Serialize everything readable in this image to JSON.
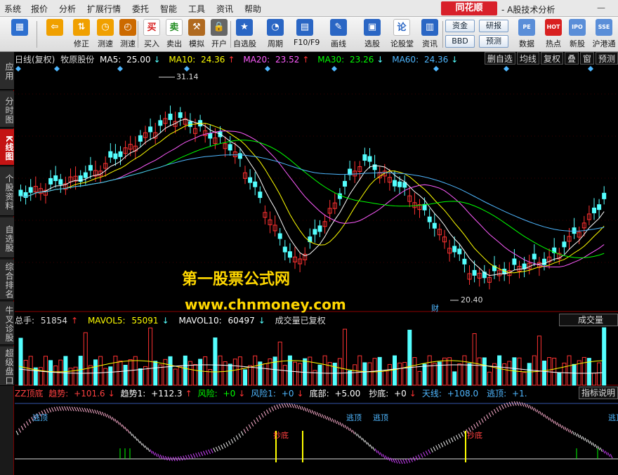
{
  "menu": {
    "items": [
      "系统",
      "报价",
      "分析",
      "扩展行情",
      "委托",
      "智能",
      "工具",
      "资讯",
      "帮助"
    ],
    "brand": "同花顺",
    "app_title": "- A股技术分析",
    "minimize": "—"
  },
  "toolbar": {
    "buttons": [
      {
        "label": "",
        "icon": "window-grid-icon",
        "color": "#2d6fcf"
      },
      {
        "label": "",
        "icon": "back-arrow-icon",
        "color": "#f0a000"
      },
      {
        "label": "修正",
        "icon": "updown-arrow-icon",
        "color": "#f0a000"
      },
      {
        "label": "测速",
        "icon": "speed-icon",
        "color": "#f0a000"
      },
      {
        "label": "测速",
        "icon": "clock-icon",
        "color": "#cc6a00"
      },
      {
        "label": "买入",
        "icon": "buy-icon",
        "color": "#d82020",
        "glyph": "买"
      },
      {
        "label": "卖出",
        "icon": "sell-icon",
        "color": "#208c20",
        "glyph": "卖"
      },
      {
        "label": "模拟",
        "icon": "hammer-icon",
        "color": "#b06a20"
      },
      {
        "label": "开户",
        "icon": "lock-icon",
        "color": "#666"
      },
      {
        "label": "自选股",
        "icon": "star-folder-icon",
        "color": "#2a66c4"
      },
      {
        "label": "周期",
        "icon": "period-clock-icon",
        "color": "#2a66c4"
      },
      {
        "label": "F10/F9",
        "icon": "f10-icon",
        "color": "#2a66c4"
      },
      {
        "label": "画线",
        "icon": "pencil-icon",
        "color": "#2a66c4"
      },
      {
        "label": "选股",
        "icon": "select-stock-icon",
        "color": "#2a66c4"
      },
      {
        "label": "论股堂",
        "icon": "forum-icon",
        "color": "#2a66c4",
        "glyph": "论"
      },
      {
        "label": "资讯",
        "icon": "news-icon",
        "color": "#2a66c4"
      }
    ],
    "boxes": [
      "资金",
      "研报",
      "BBD",
      "预测"
    ],
    "right_buttons": [
      {
        "label": "数据",
        "icon": "pe-data-icon",
        "glyph": "PE"
      },
      {
        "label": "热点",
        "icon": "hot-icon",
        "glyph": "HOT"
      },
      {
        "label": "新股",
        "icon": "ipo-icon",
        "glyph": "IPO"
      },
      {
        "label": "沪港通",
        "icon": "hk-connect-icon",
        "glyph": "SSE"
      }
    ]
  },
  "left_tabs": [
    {
      "label": "应用",
      "active": false
    },
    {
      "label": "分时图",
      "active": false
    },
    {
      "label": "K线图",
      "active": true
    },
    {
      "label": "个股资料",
      "active": false
    },
    {
      "label": "自选股",
      "active": false
    },
    {
      "label": "综合排名",
      "active": false
    },
    {
      "label": "牛叉诊股",
      "active": false
    },
    {
      "label": "超级盘口",
      "active": false
    }
  ],
  "chart_header": {
    "period": "日线(复权)",
    "stock": "牧原股份",
    "ma5": {
      "label": "MA5:",
      "value": "25.00",
      "arrow": "↓",
      "color": "#ffffff"
    },
    "ma10": {
      "label": "MA10:",
      "value": "24.36",
      "arrow": "↑",
      "color": "#ffff00"
    },
    "ma20": {
      "label": "MA20:",
      "value": "23.52",
      "arrow": "↑",
      "color": "#ff5cff"
    },
    "ma30": {
      "label": "MA30:",
      "value": "23.26",
      "arrow": "↓",
      "color": "#00ff00"
    },
    "ma60": {
      "label": "MA60:",
      "value": "24.36",
      "arrow": "↓",
      "color": "#4fb7ff"
    },
    "right_buttons": [
      "删自选",
      "均线",
      "复权",
      "叠",
      "窗",
      "预测"
    ]
  },
  "price_marks": {
    "high": "31.14",
    "low": "20.40",
    "flag": "财"
  },
  "watermark": {
    "line1": "第一股票公式网",
    "line2": "www.chnmoney.com"
  },
  "volume_header": {
    "total": {
      "label": "总手:",
      "value": "51854",
      "arrow": "↑"
    },
    "mavol5": {
      "label": "MAVOL5:",
      "value": "55091",
      "arrow": "↓"
    },
    "mavol10": {
      "label": "MAVOL10:",
      "value": "60497",
      "arrow": "↓"
    },
    "note": "成交量已复权",
    "select": "成交量"
  },
  "indicator_header": {
    "name": "ZZ顶底",
    "items": [
      {
        "label": "趋势:",
        "value": "+101.6",
        "arrow": "↓",
        "color": "#ff4040"
      },
      {
        "label": "趋势1:",
        "value": "+112.3",
        "arrow": "↑",
        "color": "#ffffff"
      },
      {
        "label": "风险:",
        "value": "+0",
        "arrow": "↓",
        "color": "#00ff00"
      },
      {
        "label": "风险1:",
        "value": "+0",
        "arrow": "↓",
        "color": "#4fb7ff"
      },
      {
        "label": "底部:",
        "value": "+5.00",
        "arrow": "",
        "color": "#ffffff"
      },
      {
        "label": "抄底:",
        "value": "+0",
        "arrow": "↓",
        "color": "#ffffff"
      },
      {
        "label": "天线:",
        "value": "+108.0",
        "arrow": "",
        "color": "#4fb7ff"
      },
      {
        "label": "逃顶:",
        "value": "+1.",
        "arrow": "",
        "color": "#4fb7ff"
      }
    ],
    "help": "指标说明",
    "signals": {
      "escape_top": "逃顶",
      "bottom": "抄底"
    }
  },
  "colors": {
    "up": "#ff3232",
    "down": "#54ffff",
    "ma5": "#ffffff",
    "ma10": "#ffff00",
    "ma20": "#ff5cff",
    "ma30": "#00ff00",
    "ma60": "#4fb7ff"
  }
}
